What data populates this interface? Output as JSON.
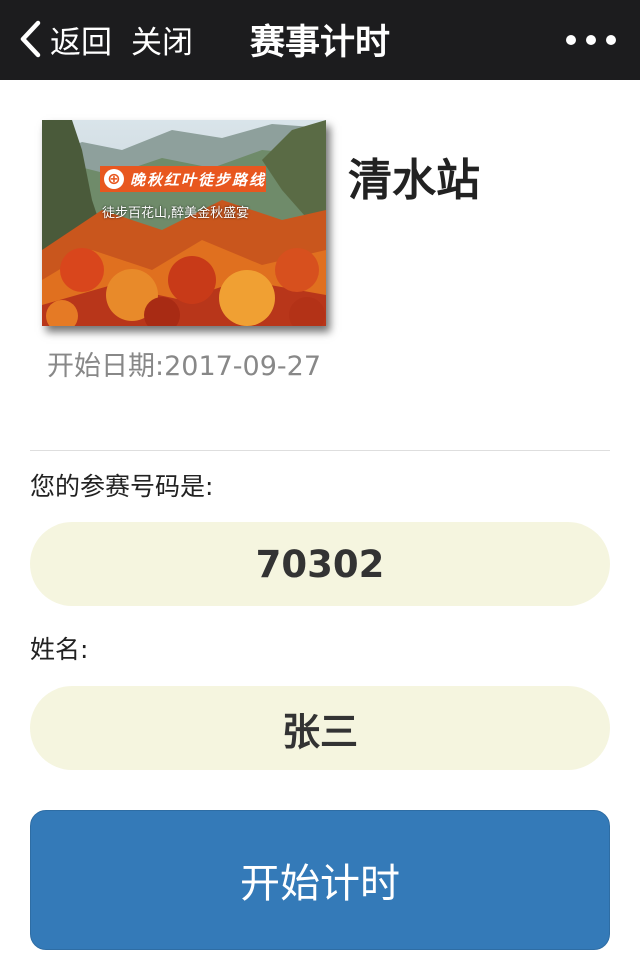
{
  "navbar": {
    "back_label": "返回",
    "close_label": "关闭",
    "title": "赛事计时",
    "more_icon": "more-dots-icon",
    "background": "#1c1c1e"
  },
  "event": {
    "cover_banner_text": "晚秋红叶徒步路线",
    "cover_subtitle": "徒步百花山,醉美金秋盛宴",
    "station_name": "清水站",
    "start_date_label": "开始日期:",
    "start_date_value": "2017-09-27"
  },
  "form": {
    "bib_label": "您的参赛号码是:",
    "bib_value": "70302",
    "name_label": "姓名:",
    "name_value": "张三",
    "field_background": "#f5f5df"
  },
  "actions": {
    "start_timer_label": "开始计时",
    "button_color": "#347ab8"
  }
}
